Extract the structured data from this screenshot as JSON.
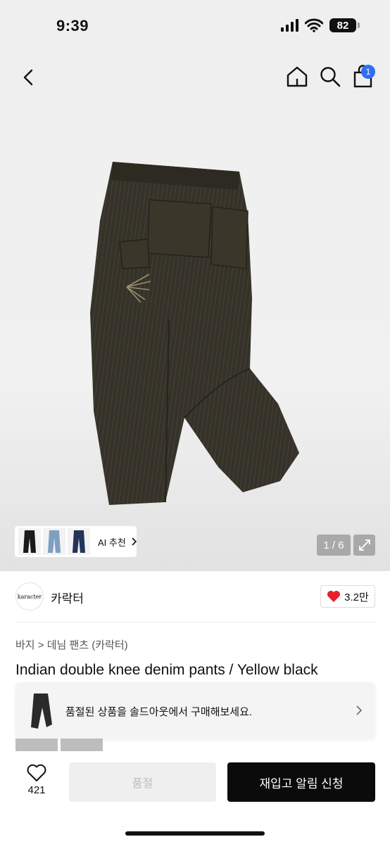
{
  "status_bar": {
    "time": "9:39",
    "battery": "82"
  },
  "nav": {
    "cart_badge": "1"
  },
  "gallery": {
    "counter": "1 / 6",
    "ai_label": "AI 추천"
  },
  "brand": {
    "logo_text": "karacter",
    "name": "카락터",
    "likes": "3.2만"
  },
  "breadcrumb": {
    "text": "바지 > 데님 팬츠 (카락터)"
  },
  "product": {
    "title": "Indian double knee denim pants / Yellow black"
  },
  "soldout_banner": {
    "text": "품절된 상품을 솔드아웃에서 구매해보세요."
  },
  "bottom_bar": {
    "wish_count": "421",
    "soldout_label": "품절",
    "restock_label": "재입고 알림 신청"
  },
  "colors": {
    "accent_blue": "#2f6ef5",
    "like_red": "#e8202a",
    "primary_black": "#0b0b0b"
  }
}
